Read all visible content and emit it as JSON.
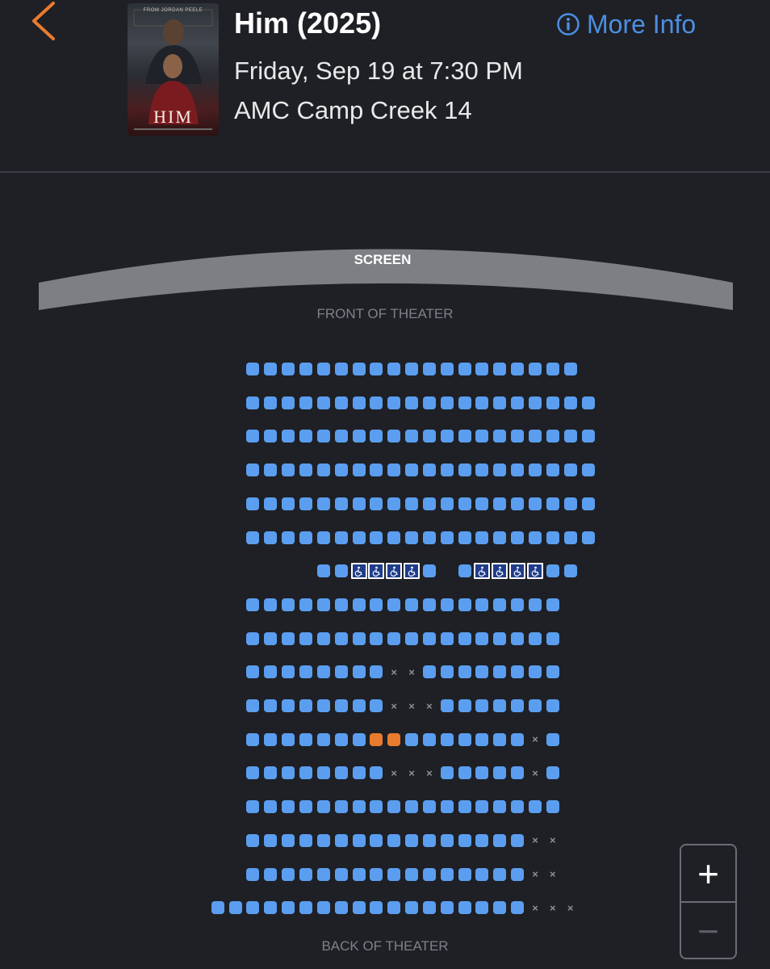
{
  "header": {
    "movie_title": "Him (2025)",
    "showtime": "Friday, Sep 19 at 7:30 PM",
    "theater": "AMC Camp Creek 14",
    "more_info_label": "More Info",
    "poster": {
      "title_text": "HIM",
      "tagline_text": "FROM JORDAN PEELE"
    }
  },
  "theater_map": {
    "screen_label": "SCREEN",
    "front_label": "FRONT OF THEATER",
    "back_label": "BACK OF THEATER",
    "legend": {
      "a": "available",
      "x": "taken",
      "s": "selected",
      "w": "wheelchair",
      "_": "gap"
    },
    "rows": [
      "....aaaaaaaaaaaaaaaaaaa",
      "....aaaaaaaaaaaaaaaaaaaa",
      "....aaaaaaaaaaaaaaaaaaaa",
      "....aaaaaaaaaaaaaaaaaaaa",
      "....aaaaaaaaaaaaaaaaaaaa",
      "....aaaaaaaaaaaaaaaaaaaa",
      "........aawwwwa_awwwwaa",
      "....aaaaaaaaaaaaaaaaaa",
      "....aaaaaaaaaaaaaaaaaa",
      "....aaaaaaaaxxaaaaaaaa",
      "....aaaaaaaaxxxaaaaaaa",
      "....aaaaaaassaaaaaaaxa",
      "....aaaaaaaaxxxaaaaaxa",
      "....aaaaaaaaaaaaaaaaaa",
      "....aaaaaaaaaaaaaaaaxx",
      "....aaaaaaaaaaaaaaaaxx",
      "..aaaaaaaaaaaaaaaaaaxxx"
    ]
  },
  "zoom": {
    "zoom_in_label": "+",
    "zoom_out_label": "−"
  },
  "colors": {
    "available": "#5b9ef0",
    "selected": "#e97b2e",
    "accent": "#4d8ee3",
    "back_arrow": "#e97b2e",
    "background": "#1e2025"
  },
  "icons": {
    "back": "chevron-left-icon",
    "info": "info-circle-icon",
    "wheelchair": "wheelchair-icon"
  }
}
